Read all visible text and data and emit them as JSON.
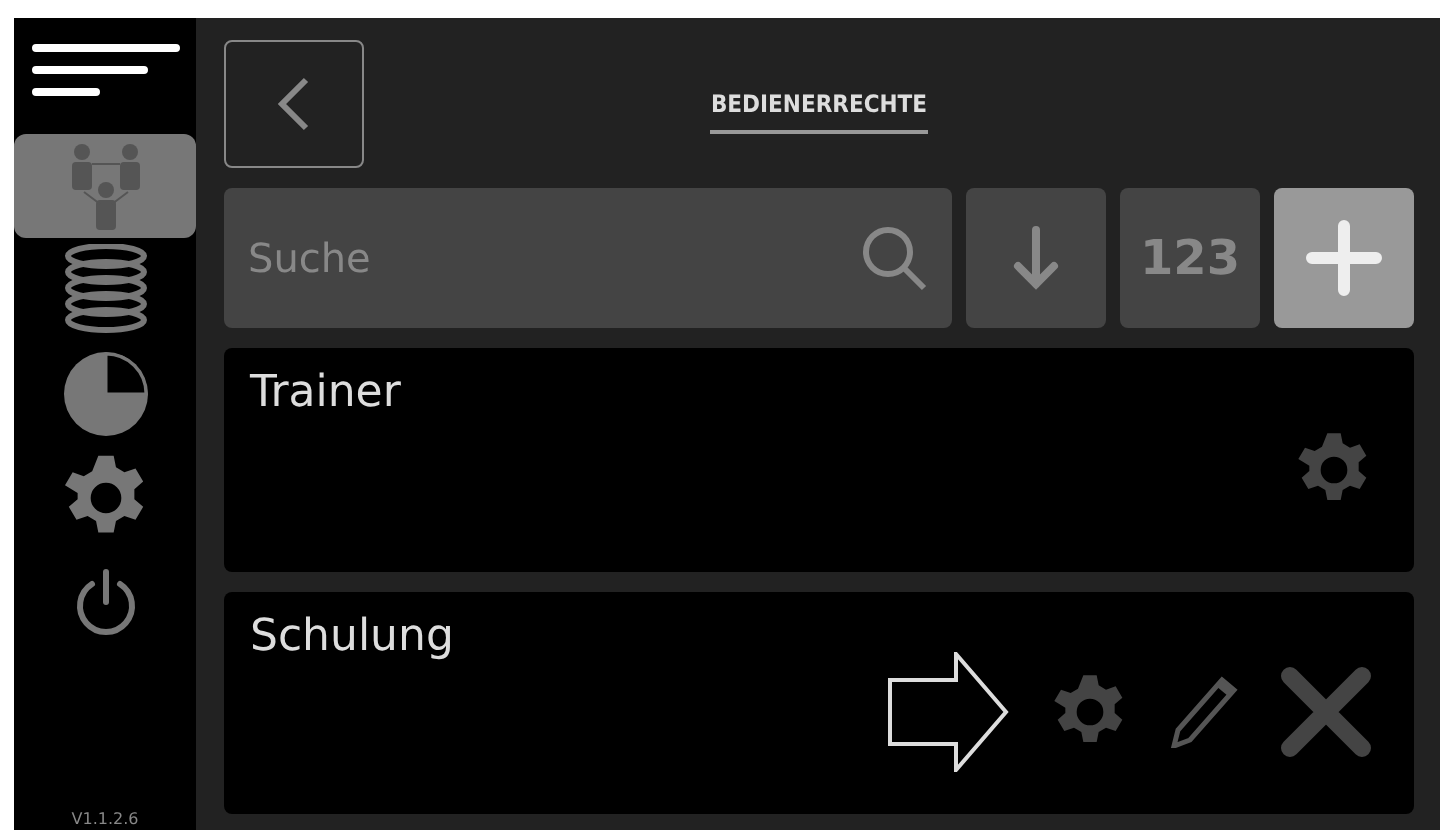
{
  "sidebar": {
    "items": [
      {
        "kind": "users",
        "selected": true
      },
      {
        "kind": "database",
        "selected": false
      },
      {
        "kind": "chart",
        "selected": false
      },
      {
        "kind": "settings",
        "selected": false
      },
      {
        "kind": "power",
        "selected": false
      }
    ],
    "version": "V1.1.2.6"
  },
  "header": {
    "title": "BEDIENERRECHTE"
  },
  "toolbar": {
    "search": {
      "placeholder": "Suche"
    },
    "number_button": "123"
  },
  "rows": [
    {
      "name": "Trainer",
      "highlighted": false,
      "editable": false
    },
    {
      "name": "Schulung",
      "highlighted": true,
      "editable": true
    }
  ]
}
